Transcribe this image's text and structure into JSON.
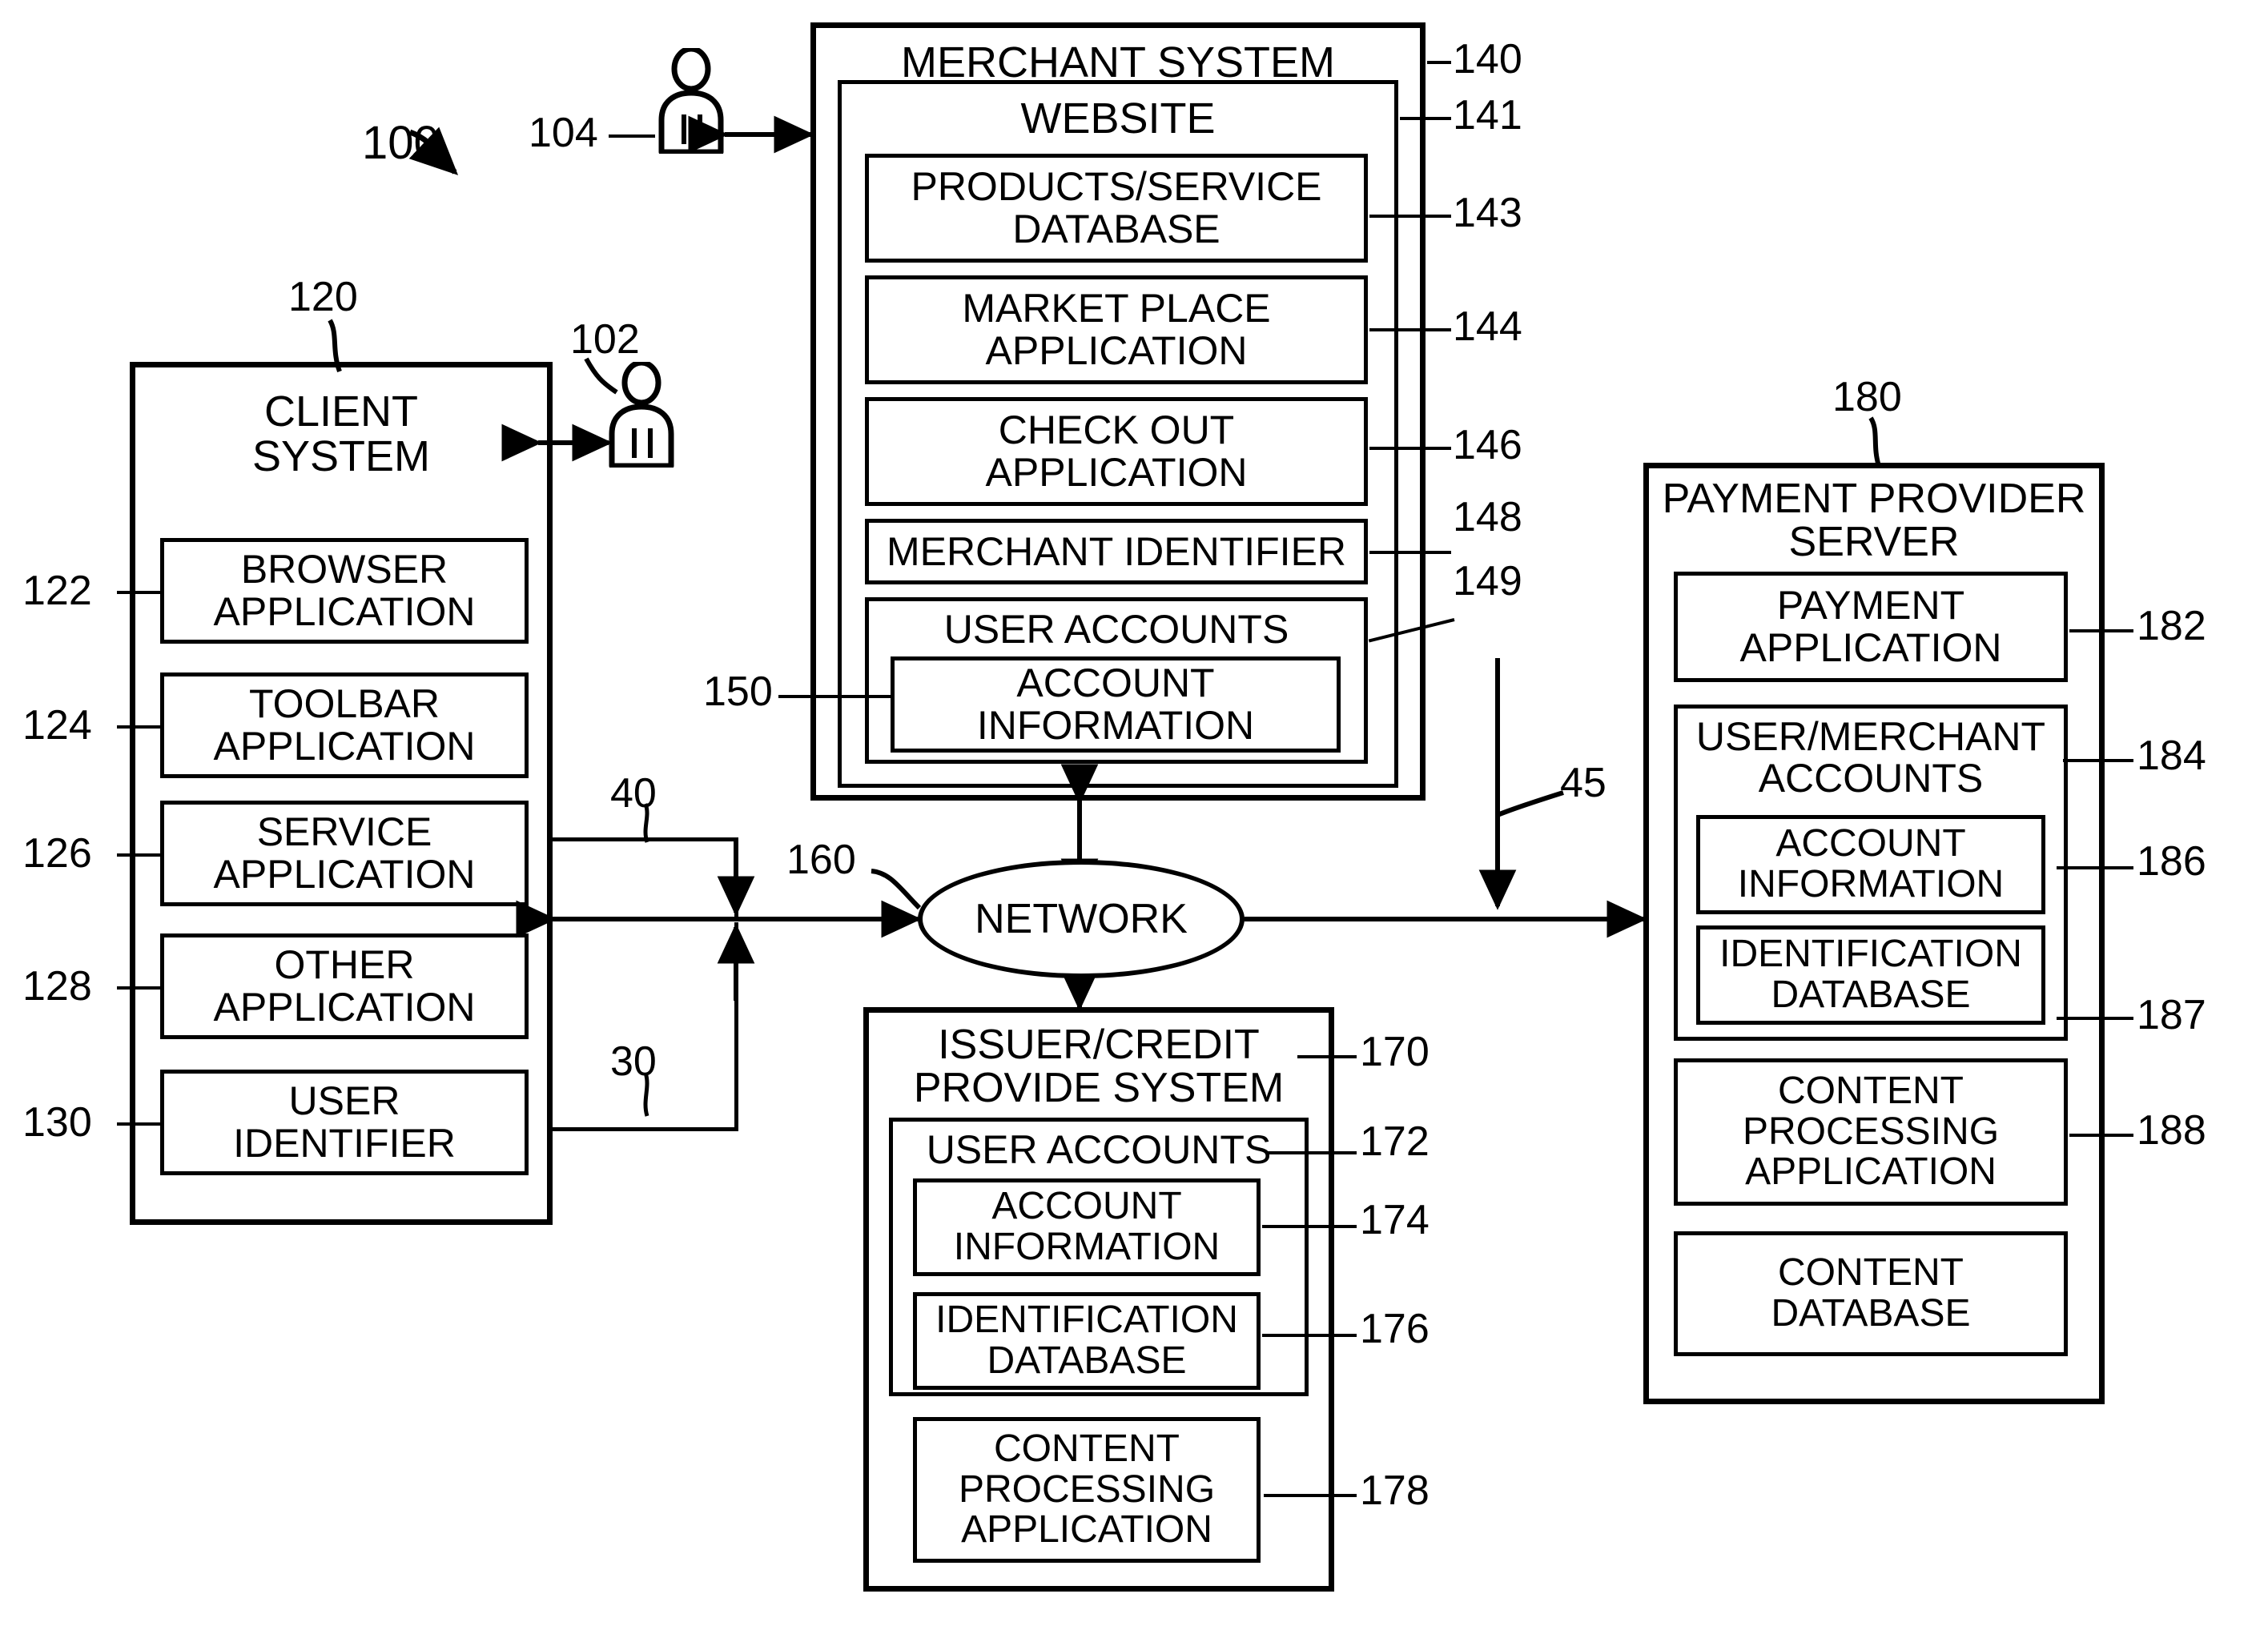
{
  "figure": {
    "system_ref": "100",
    "user_client_ref": "102",
    "user_merchant_ref": "104",
    "network_label": "NETWORK",
    "network_ref": "160",
    "link_40": "40",
    "link_30": "30",
    "link_45": "45"
  },
  "client_system": {
    "title": "CLIENT\nSYSTEM",
    "ref": "120",
    "items": [
      {
        "label": "BROWSER\nAPPLICATION",
        "ref": "122"
      },
      {
        "label": "TOOLBAR\nAPPLICATION",
        "ref": "124"
      },
      {
        "label": "SERVICE\nAPPLICATION",
        "ref": "126"
      },
      {
        "label": "OTHER\nAPPLICATION",
        "ref": "128"
      },
      {
        "label": "USER\nIDENTIFIER",
        "ref": "130"
      }
    ]
  },
  "merchant_system": {
    "title": "MERCHANT SYSTEM",
    "ref": "140",
    "website": {
      "title": "WEBSITE",
      "ref": "141",
      "items": [
        {
          "label": "PRODUCTS/SERVICE\nDATABASE",
          "ref": "143"
        },
        {
          "label": "MARKET PLACE\nAPPLICATION",
          "ref": "144"
        },
        {
          "label": "CHECK OUT\nAPPLICATION",
          "ref": "146"
        },
        {
          "label": "MERCHANT IDENTIFIER",
          "ref": "148"
        }
      ],
      "user_accounts": {
        "title": "USER ACCOUNTS",
        "ref": "149",
        "account_information": {
          "label": "ACCOUNT\nINFORMATION",
          "ref": "150"
        }
      }
    }
  },
  "issuer_system": {
    "title": "ISSUER/CREDIT\nPROVIDE SYSTEM",
    "ref": "170",
    "user_accounts": {
      "title": "USER ACCOUNTS",
      "ref": "172",
      "items": [
        {
          "label": "ACCOUNT\nINFORMATION",
          "ref": "174"
        },
        {
          "label": "IDENTIFICATION\nDATABASE",
          "ref": "176"
        }
      ]
    },
    "content_processing": {
      "label": "CONTENT\nPROCESSING\nAPPLICATION",
      "ref": "178"
    }
  },
  "payment_provider_server": {
    "title": "PAYMENT PROVIDER\nSERVER",
    "ref": "180",
    "payment_application": {
      "label": "PAYMENT\nAPPLICATION",
      "ref": "182"
    },
    "user_merchant_accounts": {
      "title": "USER/MERCHANT\nACCOUNTS",
      "ref": "184",
      "items": [
        {
          "label": "ACCOUNT\nINFORMATION",
          "ref": "186"
        },
        {
          "label": "IDENTIFICATION\nDATABASE",
          "ref": "187"
        }
      ]
    },
    "content_processing": {
      "label": "CONTENT\nPROCESSING\nAPPLICATION",
      "ref": "188"
    },
    "content_database": {
      "label": "CONTENT\nDATABASE",
      "ref": ""
    }
  }
}
